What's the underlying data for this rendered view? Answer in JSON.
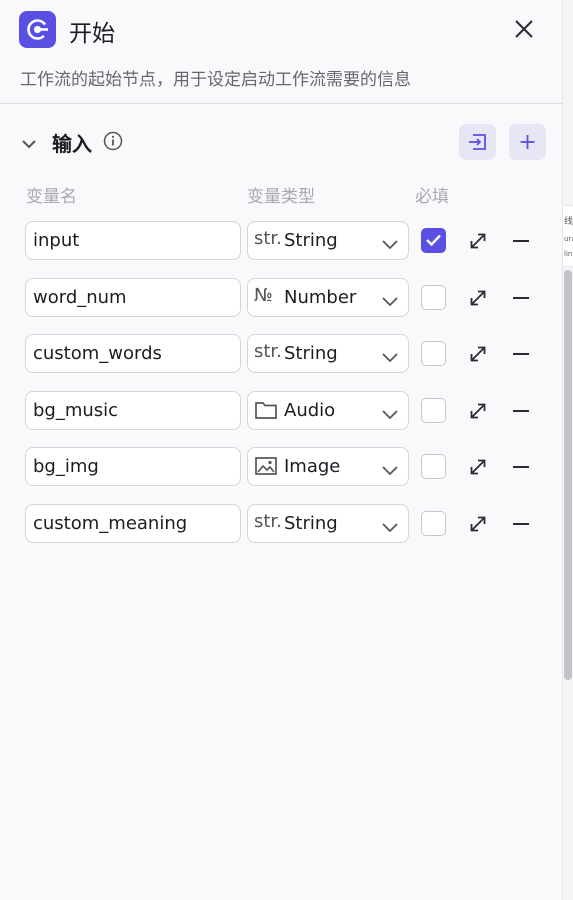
{
  "header": {
    "title": "开始",
    "description": "工作流的起始节点，用于设定启动工作流需要的信息",
    "logo_icon": "start-node-icon",
    "close_icon": "close-icon"
  },
  "input_section": {
    "title": "输入",
    "info_icon": "info-icon",
    "import_icon": "import-icon",
    "add_icon": "plus-icon"
  },
  "columns": {
    "name": "变量名",
    "type": "变量类型",
    "required": "必填"
  },
  "variables": [
    {
      "name": "input",
      "type_icon": "str.",
      "type": "String",
      "required": true
    },
    {
      "name": "word_num",
      "type_icon": "№",
      "type": "Number",
      "required": false
    },
    {
      "name": "custom_words",
      "type_icon": "str.",
      "type": "String",
      "required": false
    },
    {
      "name": "bg_music",
      "type_icon": "folder-icon",
      "type": "Audio",
      "required": false
    },
    {
      "name": "bg_img",
      "type_icon": "image-icon",
      "type": "Image",
      "required": false
    },
    {
      "name": "custom_meaning",
      "type_icon": "str.",
      "type": "String",
      "required": false
    }
  ],
  "peek_text": [
    "线",
    "ura",
    "lin"
  ],
  "colors": {
    "accent": "#5a4fe3",
    "accent_soft": "#e6e6f5",
    "text": "#1d1c23",
    "muted": "#a8a8b2"
  }
}
